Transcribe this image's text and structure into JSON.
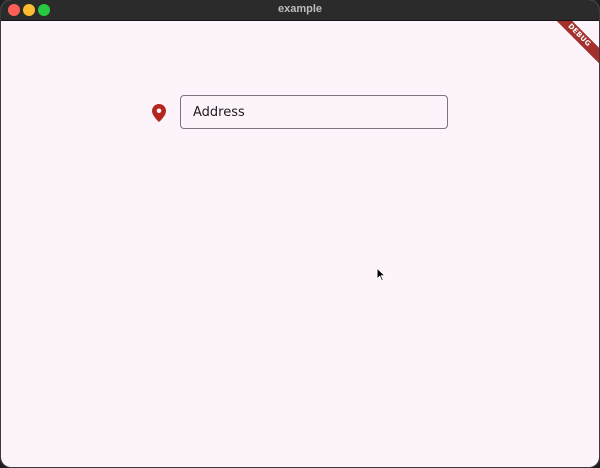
{
  "window": {
    "title": "example"
  },
  "traffic_lights": {
    "close_color": "#fe5f57",
    "minimize_color": "#febc2e",
    "maximize_color": "#28c840"
  },
  "form": {
    "address_icon": "location-pin-icon",
    "address_icon_color": "#b3261e",
    "address_placeholder": "Address",
    "address_value": ""
  },
  "debug_banner": {
    "label": "DEBUG",
    "color": "#a3302c"
  },
  "colors": {
    "background": "#fdf3fb",
    "field_border": "#7a757f"
  }
}
